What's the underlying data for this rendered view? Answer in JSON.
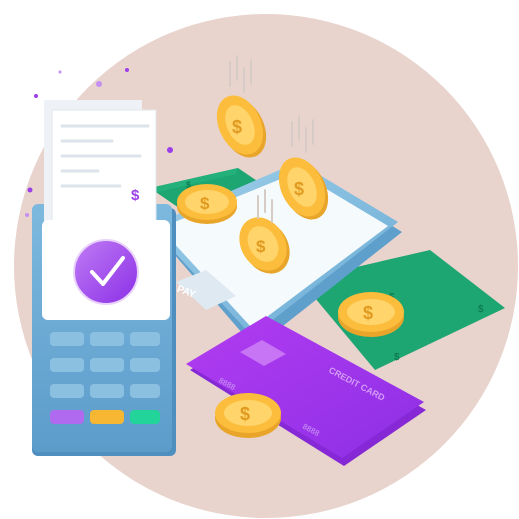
{
  "illustration": {
    "phone_button_label": "PAY",
    "card_label": "CREDIT CARD",
    "card_number_fragment_1": "8888",
    "card_number_fragment_2": "8888",
    "currency_symbol": "$"
  },
  "colors": {
    "backdrop_circle": "#e8d3cd",
    "banknote": "#1ea672",
    "coin": "#fbbd3b",
    "card": "#9e33ea",
    "terminal": "#6fb0d6",
    "check_badge": "#9b3fe8",
    "accent_purple": "#9b3fe8",
    "button_yellow": "#f7b733",
    "button_green": "#23d49a"
  },
  "icons": [
    "check-icon",
    "dollar-icon",
    "coin-icon",
    "credit-card-icon",
    "phone-icon",
    "pos-terminal-icon",
    "receipt-icon"
  ]
}
